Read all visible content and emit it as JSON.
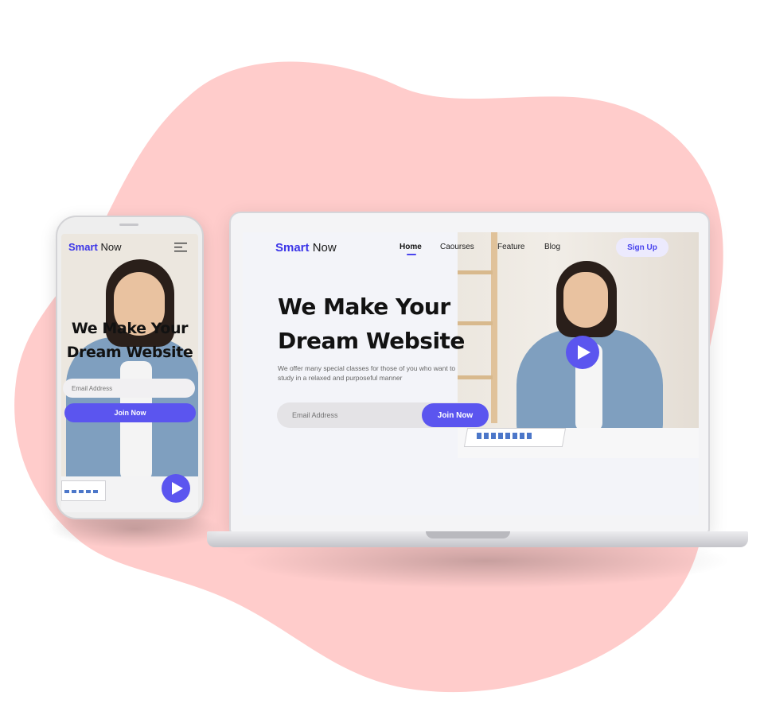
{
  "colors": {
    "blob": "#ffcccb",
    "accent": "#5b55ef",
    "brand": "#3b35e8",
    "signup_bg": "#eceafd"
  },
  "laptop": {
    "logo": {
      "brand": "Smart",
      "rest": " Now"
    },
    "nav": [
      {
        "label": "Home",
        "active": true
      },
      {
        "label": "Caourses"
      },
      {
        "label": "Feature"
      },
      {
        "label": "Blog"
      }
    ],
    "signup_label": "Sign Up",
    "hero": {
      "title_line1": "We Make Your",
      "title_line2": "Dream Website",
      "subtitle": "We offer many special classes for those of you who want to study in a relaxed and purposeful manner",
      "email_placeholder": "Email Address",
      "join_label": "Join Now"
    },
    "icons": {
      "play": "play-icon"
    }
  },
  "phone": {
    "logo": {
      "brand": "Smart",
      "rest": " Now"
    },
    "hero": {
      "title_line1": "We Make Your",
      "title_line2": "Dream Website",
      "email_placeholder": "Email Address",
      "join_label": "Join Now"
    },
    "icons": {
      "menu": "hamburger-menu-icon",
      "play": "play-icon"
    }
  }
}
